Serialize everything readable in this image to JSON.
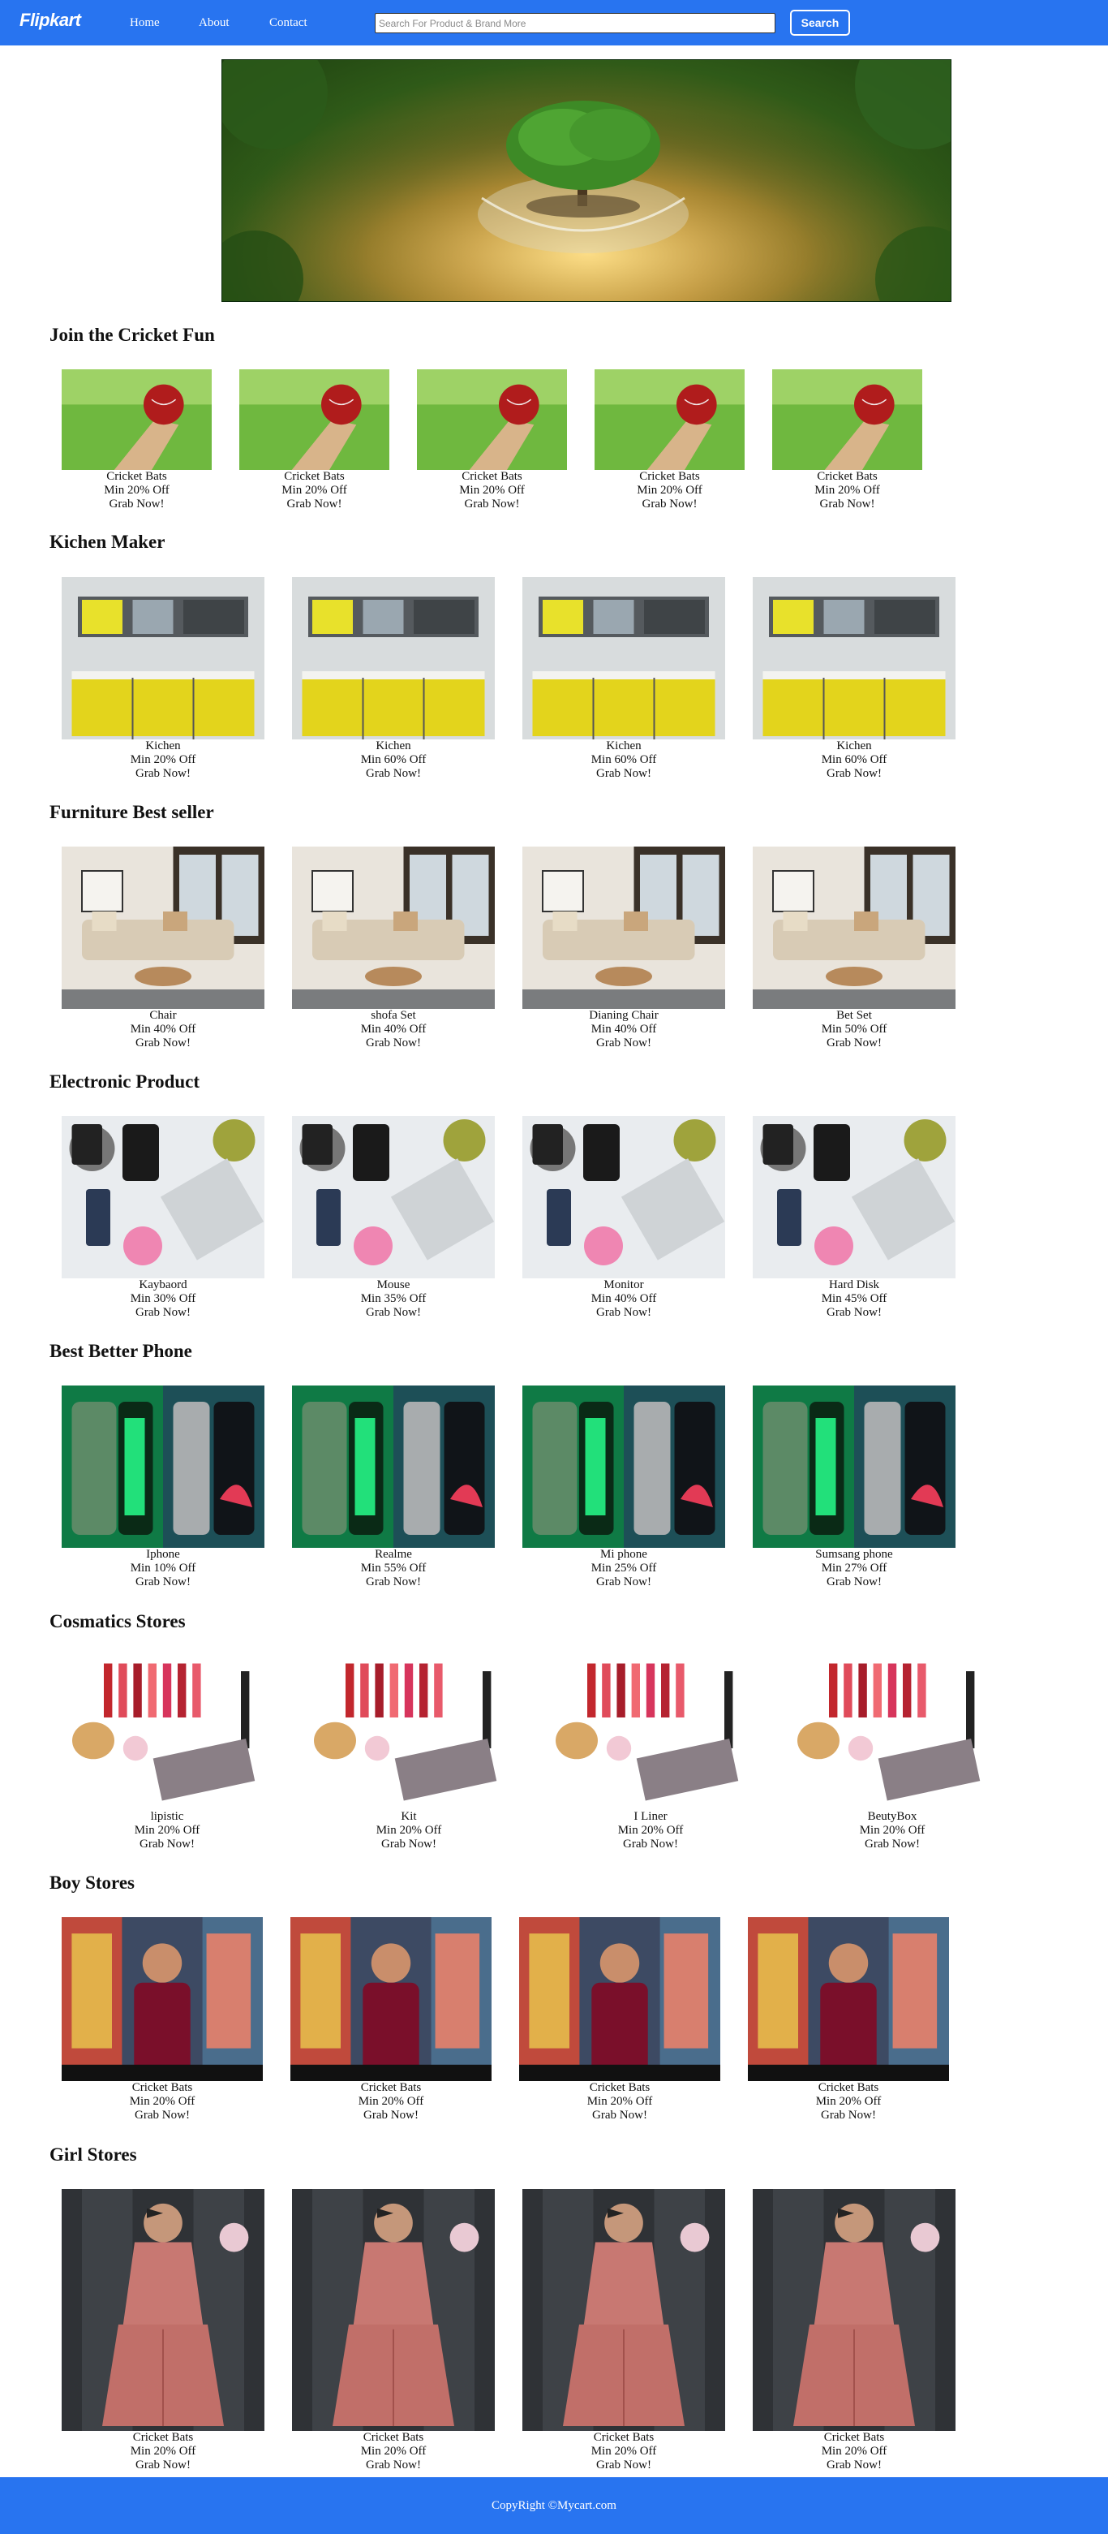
{
  "nav": {
    "logo": "Flipkart",
    "links": [
      "Home",
      "About",
      "Contact"
    ],
    "search_placeholder": "Search For Product & Brand More",
    "search_value": "",
    "search_button": "Search"
  },
  "sections": [
    {
      "title": "Join the Cricket Fun",
      "image": "cricket-bat-ball-image",
      "products": [
        {
          "name": "Cricket Bats",
          "offer": "Min 20% Off",
          "cta": "Grab Now!"
        },
        {
          "name": "Cricket Bats",
          "offer": "Min 20% Off",
          "cta": "Grab Now!"
        },
        {
          "name": "Cricket Bats",
          "offer": "Min 20% Off",
          "cta": "Grab Now!"
        },
        {
          "name": "Cricket Bats",
          "offer": "Min 20% Off",
          "cta": "Grab Now!"
        },
        {
          "name": "Cricket Bats",
          "offer": "Min 20% Off",
          "cta": "Grab Now!"
        }
      ]
    },
    {
      "title": "Kichen Maker",
      "image": "kitchen-image",
      "products": [
        {
          "name": "Kichen",
          "offer": "Min 20% Off",
          "cta": "Grab Now!"
        },
        {
          "name": "Kichen",
          "offer": "Min 60% Off",
          "cta": "Grab Now!"
        },
        {
          "name": "Kichen",
          "offer": "Min 60% Off",
          "cta": "Grab Now!"
        },
        {
          "name": "Kichen",
          "offer": "Min 60% Off",
          "cta": "Grab Now!"
        }
      ]
    },
    {
      "title": "Furniture Best seller",
      "image": "living-room-furniture-image",
      "products": [
        {
          "name": "Chair",
          "offer": "Min 40% Off",
          "cta": "Grab Now!"
        },
        {
          "name": "shofa Set",
          "offer": "Min 40% Off",
          "cta": "Grab Now!"
        },
        {
          "name": "Dianing Chair",
          "offer": "Min 40% Off",
          "cta": "Grab Now!"
        },
        {
          "name": "Bet Set",
          "offer": "Min 50% Off",
          "cta": "Grab Now!"
        }
      ]
    },
    {
      "title": "Electronic Product",
      "image": "electronics-flatlay-image",
      "products": [
        {
          "name": "Kaybaord",
          "offer": "Min 30% Off",
          "cta": "Grab Now!"
        },
        {
          "name": "Mouse",
          "offer": "Min 35% Off",
          "cta": "Grab Now!"
        },
        {
          "name": "Monitor",
          "offer": "Min 40% Off",
          "cta": "Grab Now!"
        },
        {
          "name": "Hard Disk",
          "offer": "Min 45% Off",
          "cta": "Grab Now!"
        }
      ]
    },
    {
      "title": "Best Better Phone",
      "image": "smartphones-image",
      "products": [
        {
          "name": "Iphone",
          "offer": "Min 10% Off",
          "cta": "Grab Now!"
        },
        {
          "name": "Realme",
          "offer": "Min 55% Off",
          "cta": "Grab Now!"
        },
        {
          "name": "Mi phone",
          "offer": "Min 25% Off",
          "cta": "Grab Now!"
        },
        {
          "name": "Sumsang phone",
          "offer": "Min 27% Off",
          "cta": "Grab Now!"
        }
      ]
    },
    {
      "title": "Cosmatics Stores",
      "image": "cosmetics-image",
      "products": [
        {
          "name": "lipistic",
          "offer": "Min 20% Off",
          "cta": "Grab Now!"
        },
        {
          "name": "Kit",
          "offer": "Min 20% Off",
          "cta": "Grab Now!"
        },
        {
          "name": "I Liner",
          "offer": "Min 20% Off",
          "cta": "Grab Now!"
        },
        {
          "name": "BeutyBox",
          "offer": "Min 20% Off",
          "cta": "Grab Now!"
        }
      ]
    },
    {
      "title": "Boy Stores",
      "image": "boy-clothing-image",
      "products": [
        {
          "name": "Cricket Bats",
          "offer": "Min 20% Off",
          "cta": "Grab Now!"
        },
        {
          "name": "Cricket Bats",
          "offer": "Min 20% Off",
          "cta": "Grab Now!"
        },
        {
          "name": "Cricket Bats",
          "offer": "Min 20% Off",
          "cta": "Grab Now!"
        },
        {
          "name": "Cricket Bats",
          "offer": "Min 20% Off",
          "cta": "Grab Now!"
        }
      ]
    },
    {
      "title": "Girl Stores",
      "image": "girl-dress-image",
      "products": [
        {
          "name": "Cricket Bats",
          "offer": "Min 20% Off",
          "cta": "Grab Now!"
        },
        {
          "name": "Cricket Bats",
          "offer": "Min 20% Off",
          "cta": "Grab Now!"
        },
        {
          "name": "Cricket Bats",
          "offer": "Min 20% Off",
          "cta": "Grab Now!"
        },
        {
          "name": "Cricket Bats",
          "offer": "Min 20% Off",
          "cta": "Grab Now!"
        }
      ]
    }
  ],
  "footer": {
    "text": "CopyRight ©Mycart.com"
  },
  "colors": {
    "brand": "#2874f0",
    "text": "#111111",
    "background": "#ffffff"
  }
}
